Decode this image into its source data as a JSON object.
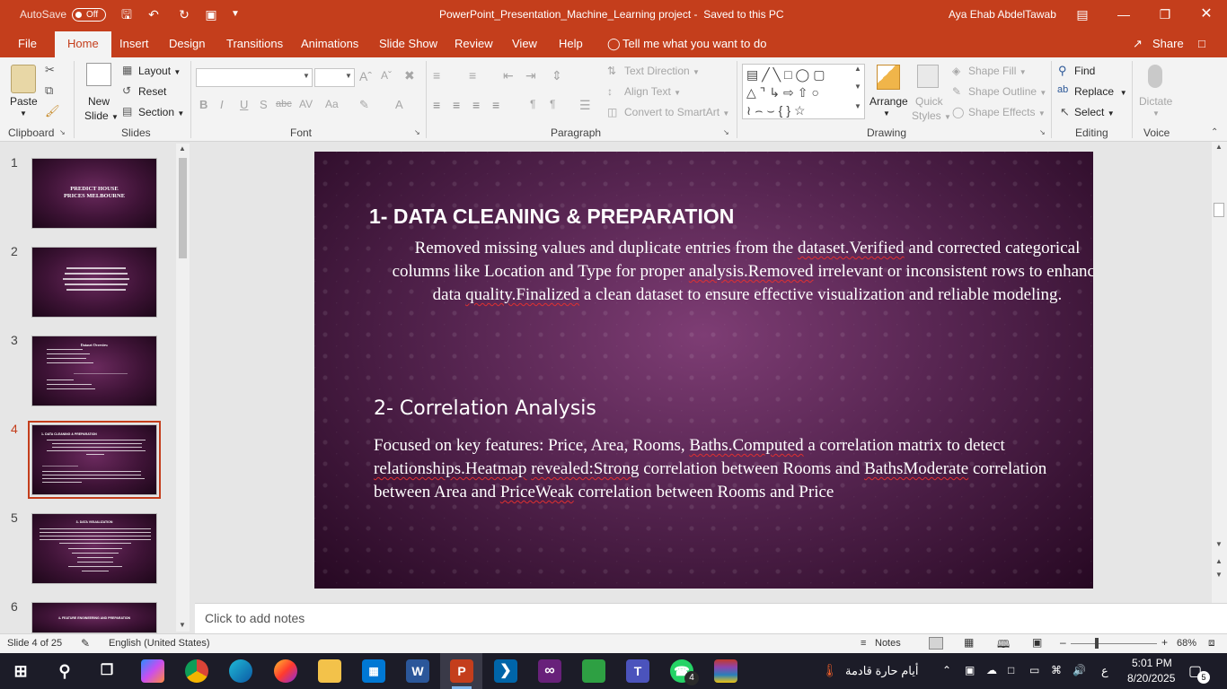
{
  "titlebar": {
    "autosave_label": "AutoSave",
    "autosave_state": "Off",
    "document_title": "PowerPoint_Presentation_Machine_Learning project",
    "save_status": "Saved to this PC",
    "user_name": "Aya Ehab AbdelTawab"
  },
  "tabs": [
    {
      "label": "File"
    },
    {
      "label": "Home"
    },
    {
      "label": "Insert"
    },
    {
      "label": "Design"
    },
    {
      "label": "Transitions"
    },
    {
      "label": "Animations"
    },
    {
      "label": "Slide Show"
    },
    {
      "label": "Review"
    },
    {
      "label": "View"
    },
    {
      "label": "Help"
    }
  ],
  "tell_me": "Tell me what you want to do",
  "share_label": "Share",
  "ribbon": {
    "clipboard": {
      "paste": "Paste",
      "group": "Clipboard"
    },
    "slides": {
      "new_slide_1": "New",
      "new_slide_2": "Slide",
      "layout": "Layout",
      "reset": "Reset",
      "section": "Section",
      "group": "Slides"
    },
    "font": {
      "group": "Font"
    },
    "paragraph": {
      "text_direction": "Text Direction",
      "align_text": "Align Text",
      "smartart": "Convert to SmartArt",
      "group": "Paragraph"
    },
    "drawing": {
      "arrange": "Arrange",
      "quick_styles_1": "Quick",
      "quick_styles_2": "Styles",
      "shape_fill": "Shape Fill",
      "shape_outline": "Shape Outline",
      "shape_effects": "Shape Effects",
      "group": "Drawing"
    },
    "editing": {
      "find": "Find",
      "replace": "Replace",
      "select": "Select",
      "group": "Editing"
    },
    "voice": {
      "dictate": "Dictate",
      "group": "Voice"
    }
  },
  "thumbnails": [
    {
      "number": "1",
      "title": "PREDICT HOUSE PRICES MELBOURNE"
    },
    {
      "number": "2"
    },
    {
      "number": "3",
      "title": "Dataset Overview"
    },
    {
      "number": "4",
      "title": "1- DATA CLEANING & PREPARATION"
    },
    {
      "number": "5",
      "title": "3- DATA VISUALIZATION"
    },
    {
      "number": "6",
      "title": "4- FEATURE ENGINEERING AND PREPARATION"
    }
  ],
  "slide": {
    "heading1": "1- DATA CLEANING & PREPARATION",
    "para1": [
      {
        "t": "Removed missing values and duplicate entries from the "
      },
      {
        "t": "dataset.Verified",
        "err": true
      },
      {
        "t": " and corrected categorical columns like Location and Type for proper "
      },
      {
        "t": "analysis.Removed",
        "err": true
      },
      {
        "t": " irrelevant or inconsistent rows to enhance data "
      },
      {
        "t": "quality.Finalized",
        "err": true
      },
      {
        "t": " a clean dataset to ensure effective visualization and reliable modeling."
      }
    ],
    "heading2": "2- Correlation Analysis",
    "para2": [
      {
        "t": "Focused on key features: Price, Area, Rooms, "
      },
      {
        "t": "Baths.Computed",
        "err": true
      },
      {
        "t": " a correlation matrix to detect "
      },
      {
        "t": "relationships.Heatmap",
        "err": true
      },
      {
        "t": " "
      },
      {
        "t": "revealed:Strong",
        "err": true
      },
      {
        "t": " correlation between Rooms and "
      },
      {
        "t": "BathsModerate",
        "err": true
      },
      {
        "t": " correlation between Area and "
      },
      {
        "t": "PriceWeak",
        "err": true
      },
      {
        "t": " correlation between Rooms and Price"
      }
    ]
  },
  "notes_placeholder": "Click to add notes",
  "status": {
    "slide_counter": "Slide 4 of 25",
    "language": "English (United States)",
    "notes": "Notes",
    "zoom": "68%"
  },
  "taskbar": {
    "weather": "أيام حارة قادمة",
    "lang": "ع",
    "time": "5:01 PM",
    "date": "8/20/2025",
    "notif": "5",
    "teams_badge": "4"
  },
  "colors": {
    "accent": "#c43e1c",
    "taskbar": "#1c1c28"
  }
}
